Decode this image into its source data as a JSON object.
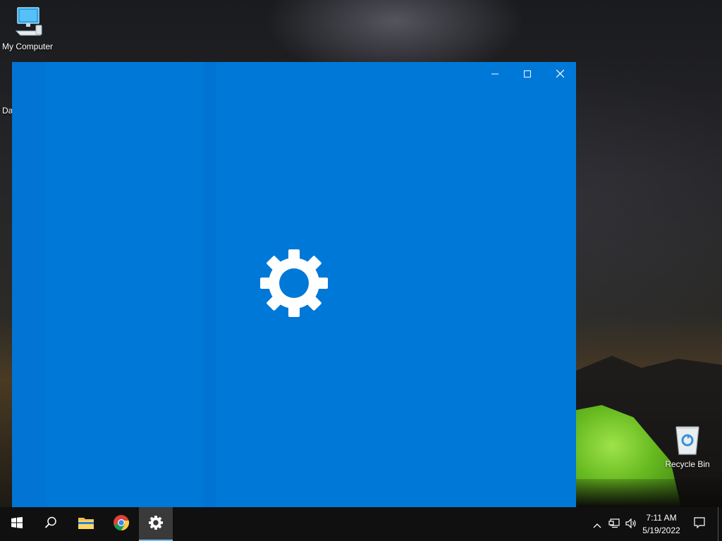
{
  "desktop": {
    "icons": [
      {
        "label": "My Computer",
        "icon": "computer-icon"
      },
      {
        "label": "Recycle Bin",
        "icon": "recycle-bin-icon"
      }
    ],
    "partial_label": "Da"
  },
  "window": {
    "app": "Settings",
    "background": "#0078d7",
    "splash_icon": "gear-icon",
    "controls": {
      "minimize": "minimize-icon",
      "maximize": "maximize-icon",
      "close": "close-icon"
    }
  },
  "taskbar": {
    "items": [
      {
        "name": "start",
        "icon": "windows-logo-icon"
      },
      {
        "name": "search",
        "icon": "search-icon"
      },
      {
        "name": "file-explorer",
        "icon": "folder-icon"
      },
      {
        "name": "chrome",
        "icon": "chrome-icon"
      },
      {
        "name": "settings",
        "icon": "gear-icon",
        "active": true
      }
    ],
    "tray": {
      "icons": [
        "chevron-up-icon",
        "network-icon",
        "volume-icon",
        "notification-icon"
      ],
      "time": "7:11 AM",
      "date": "5/19/2022"
    },
    "accent": "#76b9ed"
  }
}
